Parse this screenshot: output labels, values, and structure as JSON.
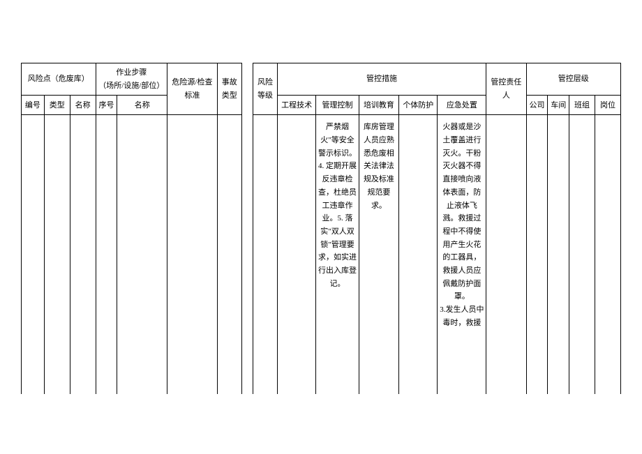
{
  "headers": {
    "risk_point": "风险点（危废库）",
    "operation_steps": "作业步骤\n（场所/设施/部位）",
    "hazard_source": "危险源/检查标准",
    "accident_type": "事故类型",
    "risk_level": "风险等级",
    "control_measures": "管控措施",
    "responsible": "管控责任人",
    "control_level": "管控层级",
    "sub": {
      "number": "编号",
      "type": "类型",
      "name": "名称",
      "seq": "序号",
      "step_name": "名称",
      "engineering": "工程技术",
      "management": "管理控制",
      "training": "培训教育",
      "ppe": "个体防护",
      "emergency": "应急处置",
      "company": "公司",
      "workshop": "车间",
      "team": "班组",
      "post": "岗位"
    }
  },
  "row": {
    "management": "严禁烟火\"等安全警示标识。4. 定期开展反违章检查，杜绝员工违章作业。5. 落实\"双人双锁\"管理要求，如实进行出入库登记。",
    "training": "库房管理人员应熟悉危废相关法律法规及标准规范要求。",
    "emergency": "火器或是沙土覆盖进行灭火。干粉灭火器不得直接喷向液体表面，防止液体飞溅。救援过程中不得使用产生火花的工器具，救援人员应佩戴防护面罩。\n3.发生人员中毒时，救援"
  }
}
